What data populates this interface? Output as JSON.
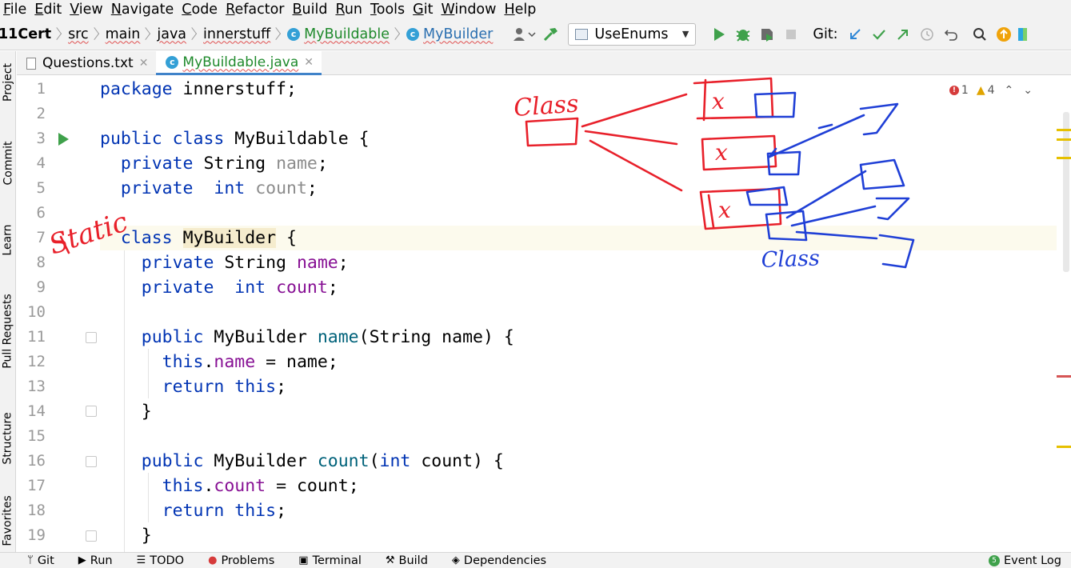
{
  "menu": [
    {
      "mnemonic": "F",
      "rest": "ile"
    },
    {
      "mnemonic": "E",
      "rest": "dit"
    },
    {
      "mnemonic": "V",
      "rest": "iew"
    },
    {
      "mnemonic": "N",
      "rest": "avigate"
    },
    {
      "mnemonic": "C",
      "rest": "ode"
    },
    {
      "mnemonic": "R",
      "rest": "efactor"
    },
    {
      "mnemonic": "B",
      "rest": "uild"
    },
    {
      "mnemonic": "R",
      "rest": "un"
    },
    {
      "mnemonic": "T",
      "rest": "ools"
    },
    {
      "mnemonic": "G",
      "rest": "it"
    },
    {
      "mnemonic": "W",
      "rest": "indow"
    },
    {
      "mnemonic": "H",
      "rest": "elp"
    }
  ],
  "breadcrumbs": {
    "project": "11Cert",
    "src": "src",
    "main": "main",
    "java": "java",
    "package": "innerstuff",
    "outer_class": "MyBuildable",
    "inner_class": "MyBuilder"
  },
  "toolbar": {
    "run_config": "UseEnums",
    "git_label": "Git:"
  },
  "left_tabs": {
    "project": "Project",
    "commit": "Commit",
    "learn": "Learn",
    "pull_requests": "Pull Requests",
    "structure": "Structure",
    "favorites": "Favorites"
  },
  "tabs": [
    {
      "label": "Questions.txt",
      "active": false
    },
    {
      "label": "MyBuildable.java",
      "active": true
    }
  ],
  "inspections": {
    "errors": "1",
    "warnings": "4"
  },
  "line_numbers": [
    "1",
    "2",
    "3",
    "4",
    "5",
    "6",
    "7",
    "8",
    "9",
    "10",
    "11",
    "12",
    "13",
    "14",
    "15",
    "16",
    "17",
    "18",
    "19"
  ],
  "code": {
    "l1": {
      "kw": "package",
      "rest": " innerstuff;"
    },
    "l3": {
      "kw1": "public",
      "kw2": "class",
      "rest": " MyBuildable {"
    },
    "l4": {
      "kw": "private",
      "type": " String ",
      "field": "name",
      "end": ";"
    },
    "l5": {
      "kw": "private",
      "type": " int",
      "field": "count",
      "end": ";"
    },
    "l7": {
      "kw": "class",
      "name": "MyBuilder",
      "end": " {"
    },
    "l8": {
      "kw": "private",
      "type": " String ",
      "field": "name",
      "end": ";"
    },
    "l9": {
      "kw": "private",
      "type": " int",
      "field": "count",
      "end": ";"
    },
    "l11": {
      "kw": "public",
      "type": " MyBuilder ",
      "method": "name",
      "params": "(String name) {"
    },
    "l12": {
      "kw": "this",
      "dot": ".",
      "field": "name",
      "rest": " = name;"
    },
    "l13": {
      "kw1": "return",
      "kw2": "this",
      "end": ";"
    },
    "l14": {
      "rest": "}"
    },
    "l16": {
      "kw": "public",
      "type": " MyBuilder ",
      "method": "count",
      "open": "(",
      "kw2": "int",
      "params": " count) {"
    },
    "l17": {
      "kw": "this",
      "dot": ".",
      "field": "count",
      "rest": " = count;"
    },
    "l18": {
      "kw1": "return",
      "kw2": "this",
      "end": ";"
    },
    "l19": {
      "rest": "}"
    }
  },
  "bottom_tools": {
    "git": "Git",
    "run": "Run",
    "todo": "TODO",
    "problems": "Problems",
    "terminal": "Terminal",
    "build": "Build",
    "dependencies": "Dependencies",
    "event_log": "Event Log"
  },
  "handwriting": {
    "static_note": "Static",
    "class_note_red": "Class",
    "class_note_blue": "Class",
    "x_labels": [
      "x",
      "x",
      "x"
    ]
  },
  "colors": {
    "keyword": "#0033b3",
    "field": "#871094",
    "method": "#00627a",
    "pen_red": "#e8202a",
    "pen_blue": "#1f3fd6"
  }
}
